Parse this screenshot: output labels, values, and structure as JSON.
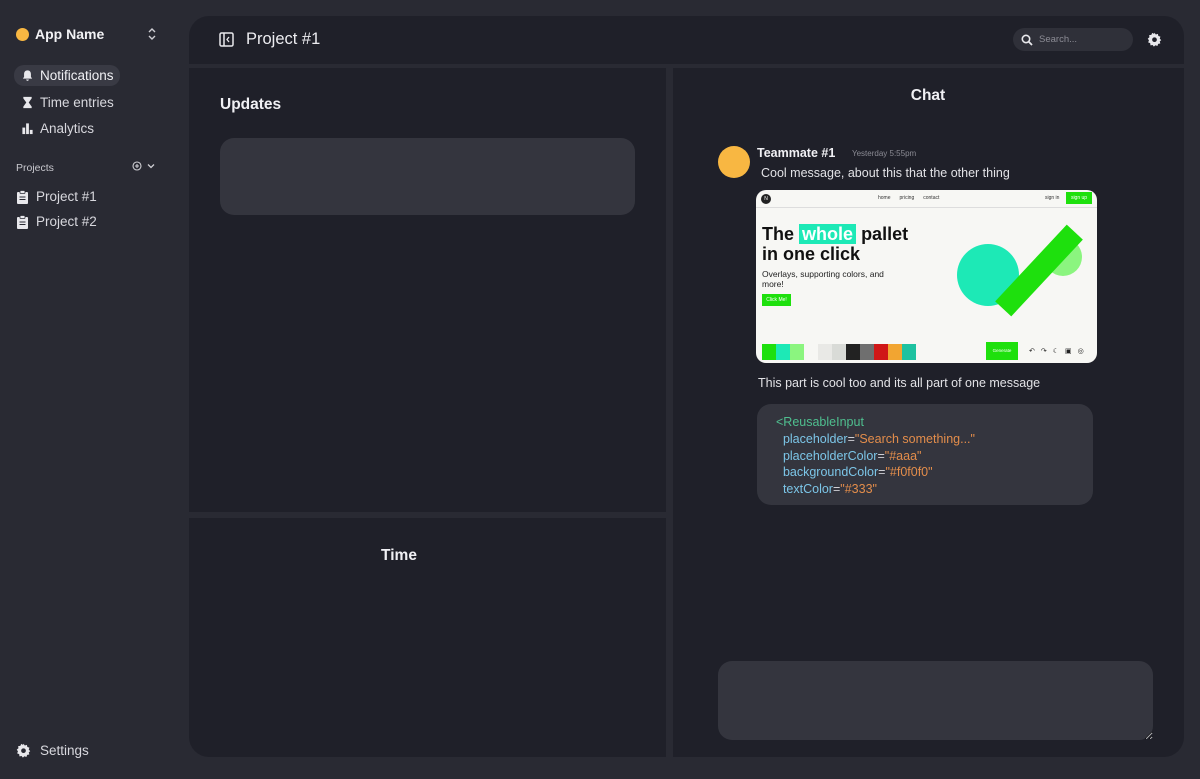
{
  "app": {
    "name": "App Name"
  },
  "nav": [
    {
      "label": "Notifications",
      "icon": "bell-icon",
      "active": true
    },
    {
      "label": "Time entries",
      "icon": "hourglass-icon",
      "active": false
    },
    {
      "label": "Analytics",
      "icon": "bar-chart-icon",
      "active": false
    }
  ],
  "projects": {
    "header": "Projects",
    "items": [
      {
        "label": "Project #1",
        "icon": "clipboard-icon"
      },
      {
        "label": "Project #2",
        "icon": "clipboard-icon"
      }
    ]
  },
  "settings_label": "Settings",
  "topbar": {
    "title": "Project #1",
    "search_placeholder": "Search..."
  },
  "updates": {
    "title": "Updates"
  },
  "time": {
    "title": "Time"
  },
  "chat": {
    "title": "Chat",
    "message": {
      "author": "Teammate #1",
      "time": "Yesterday 5:55pm",
      "text": "Cool message, about this that the other thing",
      "text2": "This part is cool too and its all part of one message"
    },
    "preview": {
      "logo": "N",
      "links": [
        "home",
        "pricing",
        "contact"
      ],
      "sign_in": "sign in",
      "sign_up": "sign up",
      "head_pre": "The",
      "head_hl": "whole",
      "head_post": "pallet",
      "head_line2": "in one click",
      "sub": "Overlays, supporting colors, and more!",
      "button": "Click Me!",
      "generate": "Generate",
      "swatches": [
        "#1ee00d",
        "#1de9b6",
        "#8bf57f",
        "#f7f7f4",
        "#e9e9e6",
        "#d9dbd7",
        "#222222",
        "#6f6f6f",
        "#d01717",
        "#f2a531",
        "#1ec2a0"
      ]
    },
    "code": {
      "tag": "<ReusableInput",
      "attrs": [
        {
          "name": "placeholder",
          "value": "\"Search something...\""
        },
        {
          "name": "placeholderColor",
          "value": "\"#aaa\""
        },
        {
          "name": "backgroundColor",
          "value": "\"#f0f0f0\""
        },
        {
          "name": "textColor",
          "value": "\"#333\""
        }
      ]
    }
  },
  "colors": {
    "accent": "#f8b742",
    "background": "#292a33",
    "panel": "#1f2029",
    "card": "#34353e"
  }
}
